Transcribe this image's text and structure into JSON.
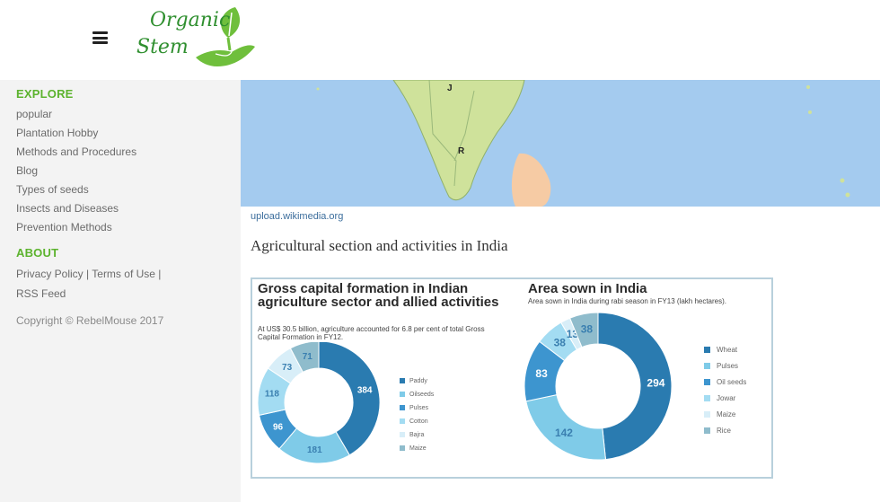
{
  "header": {
    "logo_line1": "Organic",
    "logo_line2": "Stem"
  },
  "sidebar": {
    "explore_heading": "EXPLORE",
    "explore_items": [
      "popular",
      "Plantation Hobby",
      "Methods and Procedures",
      "Blog",
      "Types of seeds",
      "Insects and Diseases",
      "Prevention Methods"
    ],
    "about_heading": "ABOUT",
    "about_links": [
      "Privacy Policy",
      "Terms of Use",
      "RSS Feed"
    ],
    "copyright": "Copyright © RebelMouse 2017"
  },
  "map": {
    "label_j": "J",
    "label_r": "R"
  },
  "main": {
    "image_source": "upload.wikimedia.org",
    "section_title": "Agricultural section and activities in India"
  },
  "colors": {
    "accent_green": "#5cb32e",
    "sea": "#a4cbef",
    "land": "#cfe29b"
  },
  "chart_data": [
    {
      "type": "pie",
      "title": "Gross capital formation in Indian agriculture sector and allied activities",
      "subtitle": "At US$ 30.5 billion, agriculture accounted for 6.8 per cent of total Gross Capital Formation in FY12.",
      "categories": [
        "Paddy",
        "Oilseeds",
        "Pulses",
        "Cotton",
        "Bajra",
        "Maize"
      ],
      "values": [
        384,
        181,
        96,
        118,
        73,
        71
      ],
      "colors": [
        "#2a7bb0",
        "#7fcbe8",
        "#3d95cf",
        "#a3dcf2",
        "#d8eef8",
        "#8fbccc"
      ]
    },
    {
      "type": "pie",
      "title": "Area sown in India",
      "subtitle": "Area sown in India during rabi season in FY13 (lakh hectares).",
      "categories": [
        "Wheat",
        "Pulses",
        "Oil seeds",
        "Jowar",
        "Maize",
        "Rice"
      ],
      "values": [
        294,
        142,
        83,
        38,
        13,
        38
      ],
      "colors": [
        "#2a7bb0",
        "#7fcbe8",
        "#3d95cf",
        "#a3dcf2",
        "#d8eef8",
        "#8fbccc"
      ]
    }
  ]
}
